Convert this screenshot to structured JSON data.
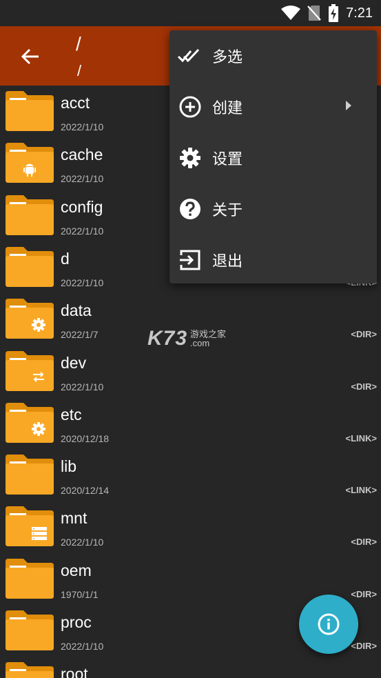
{
  "status_bar": {
    "time": "7:21",
    "icons": [
      "wifi-icon",
      "no-sim-icon",
      "battery-charging-icon"
    ]
  },
  "app_bar": {
    "title": "/",
    "subtitle": "/",
    "back_icon": "arrow-left-icon"
  },
  "files": [
    {
      "name": "acct",
      "date": "2022/1/10",
      "type": "",
      "emblem": "none"
    },
    {
      "name": "cache",
      "date": "2022/1/10",
      "type": "",
      "emblem": "android"
    },
    {
      "name": "config",
      "date": "2022/1/10",
      "type": "",
      "emblem": "none"
    },
    {
      "name": "d",
      "date": "2022/1/10",
      "type": "<LINK>",
      "emblem": "none"
    },
    {
      "name": "data",
      "date": "2022/1/7",
      "type": "<DIR>",
      "emblem": "gear"
    },
    {
      "name": "dev",
      "date": "2022/1/10",
      "type": "<DIR>",
      "emblem": "arrows"
    },
    {
      "name": "etc",
      "date": "2020/12/18",
      "type": "<LINK>",
      "emblem": "gear"
    },
    {
      "name": "lib",
      "date": "2020/12/14",
      "type": "<LINK>",
      "emblem": "none"
    },
    {
      "name": "mnt",
      "date": "2022/1/10",
      "type": "<DIR>",
      "emblem": "storage"
    },
    {
      "name": "oem",
      "date": "1970/1/1",
      "type": "<DIR>",
      "emblem": "none"
    },
    {
      "name": "proc",
      "date": "2022/1/10",
      "type": "<DIR>",
      "emblem": "none"
    },
    {
      "name": "root",
      "date": "",
      "type": "",
      "emblem": "none"
    }
  ],
  "menu": {
    "items": [
      {
        "label": "多选",
        "icon": "double-check-icon",
        "has_submenu": false
      },
      {
        "label": "创建",
        "icon": "add-circle-icon",
        "has_submenu": true
      },
      {
        "label": "设置",
        "icon": "gear-icon",
        "has_submenu": false
      },
      {
        "label": "关于",
        "icon": "help-circle-icon",
        "has_submenu": false
      },
      {
        "label": "退出",
        "icon": "exit-icon",
        "has_submenu": false
      }
    ]
  },
  "watermark": {
    "big": "K73",
    "line1": "游戏之家",
    "line2": ".com"
  },
  "fab": {
    "icon": "info-icon"
  },
  "colors": {
    "app_bar": "#a23305",
    "background": "#262626",
    "folder": "#f9a825",
    "menu": "#333333",
    "fab": "#2eaec8"
  }
}
